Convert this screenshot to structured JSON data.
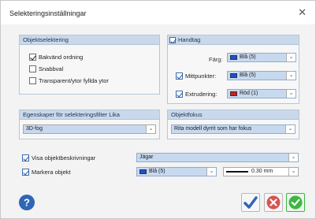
{
  "window": {
    "title": "Selekteringsinställningar",
    "close_icon": "close-icon"
  },
  "panel_selection": {
    "header": "Objektselektering",
    "options": [
      {
        "label": "Bakvänd ordning",
        "checked": true
      },
      {
        "label": "Snabbval",
        "checked": false
      },
      {
        "label": "Transparent/ytor fyllda ytor",
        "checked": false
      }
    ]
  },
  "panel_highlight": {
    "header": "Handtag",
    "header_checked": true,
    "rows": [
      {
        "label": "Färg:",
        "checked": null,
        "value": "Blå (5)",
        "color": "#1e4fd6"
      },
      {
        "label": "Mittpunkter:",
        "checked": true,
        "value": "Blå (5)",
        "color": "#1e4fd6"
      },
      {
        "label": "Extrudering:",
        "checked": true,
        "value": "Röd (1)",
        "color": "#d41c1c"
      }
    ]
  },
  "panel_props": {
    "header": "Egenskaper för selekteringsfilter Lika",
    "value": "3D-fog"
  },
  "panel_focus": {
    "header": "Objektfokus",
    "value": "Rita modell dyrrit som har fokus"
  },
  "bottom": {
    "show_desc": {
      "label": "Visa objektbeskrivningar",
      "checked": true,
      "value": "Jägar"
    },
    "mark_object": {
      "label": "Markera objekt",
      "checked": true,
      "color_value": "Blå (5)",
      "color": "#1e4fd6",
      "line_value": "0.30 mm"
    }
  },
  "buttons": {
    "help_icon": "help-icon",
    "apply_icon": "checkmark-icon",
    "cancel_icon": "cancel-icon",
    "ok_icon": "ok-icon"
  },
  "colors": {
    "header_bg": "#c9d8ea",
    "accent_blue": "#2f66b5",
    "cancel_red": "#d9534f",
    "ok_green": "#3fb544"
  }
}
